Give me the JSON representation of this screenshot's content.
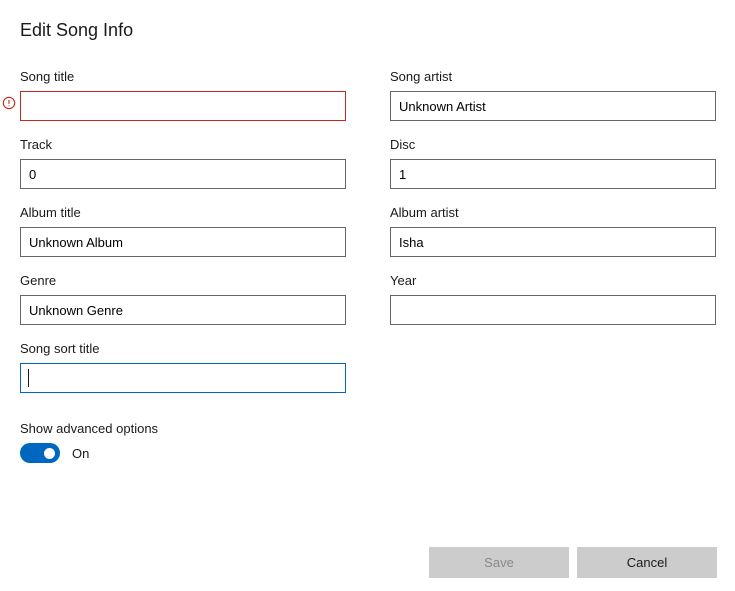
{
  "dialog_title": "Edit Song Info",
  "fields": {
    "song_title": {
      "label": "Song title",
      "value": "",
      "error": true
    },
    "song_artist": {
      "label": "Song artist",
      "value": "Unknown Artist"
    },
    "track": {
      "label": "Track",
      "value": "0"
    },
    "disc": {
      "label": "Disc",
      "value": "1"
    },
    "album_title": {
      "label": "Album title",
      "value": "Unknown Album"
    },
    "album_artist": {
      "label": "Album artist",
      "value": "Isha"
    },
    "genre": {
      "label": "Genre",
      "value": "Unknown Genre"
    },
    "year": {
      "label": "Year",
      "value": ""
    },
    "song_sort_title": {
      "label": "Song sort title",
      "value": "",
      "focused": true
    }
  },
  "advanced": {
    "label": "Show advanced options",
    "on": true,
    "state_text": "On"
  },
  "buttons": {
    "save": {
      "label": "Save",
      "enabled": false
    },
    "cancel": {
      "label": "Cancel",
      "enabled": true
    }
  }
}
